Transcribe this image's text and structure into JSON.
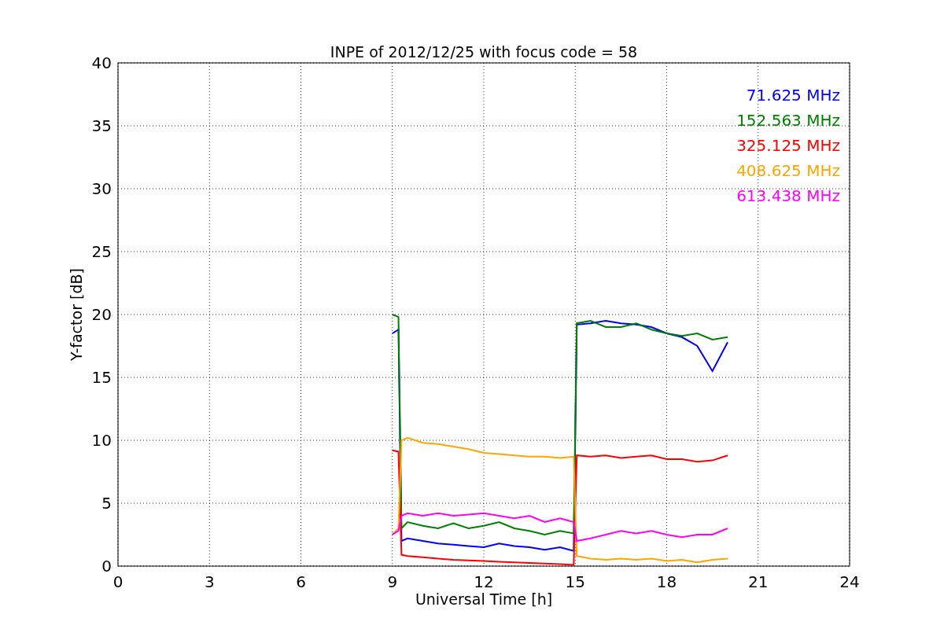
{
  "figure": {
    "chart_data": {
      "type": "line",
      "title": "INPE of 2012/12/25 with focus code = 58",
      "xlabel": "Universal Time [h]",
      "ylabel": "Y-factor [dB]",
      "x": [
        9.0,
        9.2,
        9.3,
        9.5,
        10,
        10.5,
        11,
        11.5,
        12,
        12.5,
        13,
        13.5,
        14,
        14.5,
        14.95,
        15.05,
        15.5,
        16,
        16.5,
        17,
        17.5,
        18,
        18.5,
        19,
        19.5,
        20
      ],
      "series": [
        {
          "name": "71.625 MHz",
          "color": "#0000ff",
          "values": [
            18.5,
            18.8,
            2.0,
            2.2,
            2.0,
            1.8,
            1.7,
            1.6,
            1.5,
            1.8,
            1.6,
            1.5,
            1.3,
            1.5,
            1.2,
            19.2,
            19.3,
            19.5,
            19.3,
            19.2,
            19.0,
            18.5,
            18.2,
            17.5,
            15.5,
            17.8
          ]
        },
        {
          "name": "152.563 MHz",
          "color": "#008000",
          "values": [
            20,
            19.8,
            3.0,
            3.5,
            3.2,
            3.0,
            3.4,
            3.0,
            3.2,
            3.5,
            3.0,
            2.8,
            2.5,
            2.8,
            2.6,
            19.3,
            19.5,
            19.0,
            19.0,
            19.3,
            18.8,
            18.5,
            18.3,
            18.5,
            18.0,
            18.2
          ]
        },
        {
          "name": "325.125 MHz",
          "color": "#ff0000",
          "values": [
            9.2,
            9.1,
            0.9,
            0.8,
            0.7,
            0.6,
            0.5,
            0.45,
            0.4,
            0.35,
            0.3,
            0.25,
            0.2,
            0.15,
            0.1,
            8.8,
            8.7,
            8.8,
            8.6,
            8.7,
            8.8,
            8.5,
            8.5,
            8.3,
            8.4,
            8.8
          ]
        },
        {
          "name": "408.625 MHz",
          "color": "#ffa500",
          "values": [
            2.5,
            3.0,
            10.0,
            10.2,
            9.8,
            9.7,
            9.5,
            9.3,
            9.0,
            8.9,
            8.8,
            8.7,
            8.7,
            8.6,
            8.7,
            0.8,
            0.6,
            0.5,
            0.6,
            0.5,
            0.6,
            0.4,
            0.5,
            0.3,
            0.5,
            0.6
          ]
        },
        {
          "name": "613.438 MHz",
          "color": "#ff00ff",
          "values": [
            2.5,
            2.8,
            4.0,
            4.2,
            4.0,
            4.2,
            4.0,
            4.1,
            4.2,
            4.0,
            3.8,
            4.0,
            3.5,
            3.8,
            3.5,
            2.0,
            2.2,
            2.5,
            2.8,
            2.6,
            2.8,
            2.5,
            2.3,
            2.5,
            2.5,
            3.0
          ]
        }
      ],
      "grid": true,
      "xlim": [
        0,
        24
      ],
      "ylim": [
        0,
        40
      ],
      "xticks": [
        0,
        3,
        6,
        9,
        12,
        15,
        18,
        21,
        24
      ],
      "yticks": [
        0,
        5,
        10,
        15,
        20,
        25,
        30,
        35,
        40
      ]
    }
  }
}
